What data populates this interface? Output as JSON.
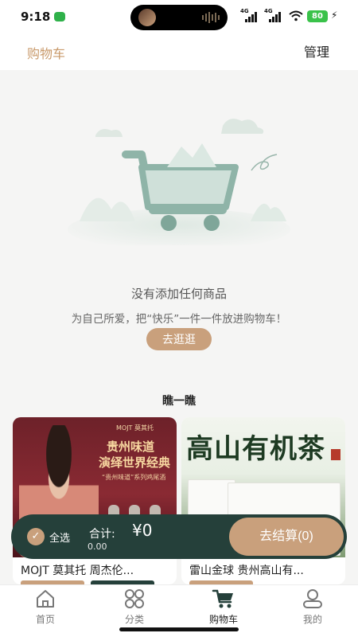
{
  "status_bar": {
    "time": "9:18",
    "signal_label_1": "4G",
    "signal_label_2": "4G",
    "battery": "80"
  },
  "header": {
    "title": "购物车",
    "manage_label": "管理"
  },
  "empty_state": {
    "title": "没有添加任何商品",
    "subtitle": "为自己所爱，把“快乐”一件一件放进购物车！",
    "button_label": "去逛逛"
  },
  "recommend": {
    "section_title": "瞧一瞧",
    "products": [
      {
        "name": "MOJT 莫其托 周杰伦...",
        "image_text": {
          "logo": "MOJT 莫其托",
          "line1": "贵州味道",
          "line2": "演绎世界经典",
          "line3": "“贵州味道”系列鸡尾酒"
        }
      },
      {
        "name": "雷山金球 贵州高山有...",
        "image_text": {
          "headline": "高山有机茶"
        }
      }
    ]
  },
  "checkout_bar": {
    "select_all_label": "全选",
    "total_label": "合计:",
    "total_value": "¥0",
    "total_sub": "0.00",
    "checkout_button": "去结算(0)"
  },
  "tab_bar": {
    "tabs": [
      {
        "label": "首页",
        "icon": "home-icon",
        "active": false
      },
      {
        "label": "分类",
        "icon": "grid-icon",
        "active": false
      },
      {
        "label": "购物车",
        "icon": "cart-icon",
        "active": true
      },
      {
        "label": "我的",
        "icon": "user-icon",
        "active": false
      }
    ]
  },
  "colors": {
    "accent": "#c9a07c",
    "dark_green": "#25403a",
    "background": "#f5f5f4"
  }
}
